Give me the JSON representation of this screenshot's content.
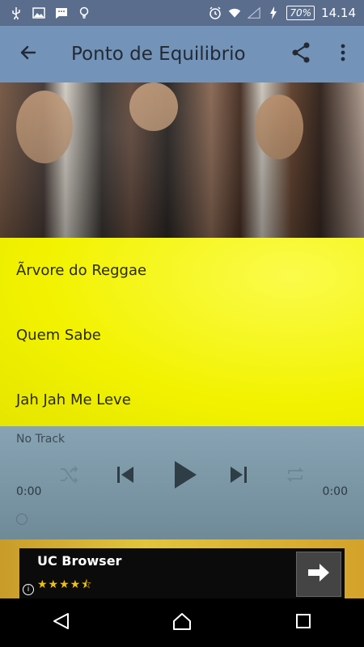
{
  "status_bar": {
    "battery": "70%",
    "time": "14.14",
    "icons": [
      "usb-icon",
      "image-icon",
      "bbm-icon",
      "bulb-icon",
      "alarm-icon",
      "wifi-icon",
      "signal-icon",
      "charging-icon"
    ]
  },
  "app_bar": {
    "title": "Ponto de Equilibrio",
    "icons": [
      "back-arrow-icon",
      "share-icon",
      "overflow-menu-icon"
    ]
  },
  "tracks": [
    "Ãrvore do Reggae",
    "Quem Sabe",
    "Jah Jah Me Leve"
  ],
  "player": {
    "now_playing": "No Track",
    "elapsed": "0:00",
    "duration": "0:00",
    "controls": [
      "shuffle-icon",
      "previous-icon",
      "play-icon",
      "next-icon",
      "repeat-icon"
    ]
  },
  "ad": {
    "app_name": "UC Browser",
    "rating": 4.5,
    "stars_text": "★★★★⯪",
    "info": "i"
  },
  "nav": [
    "back-nav-icon",
    "home-nav-icon",
    "recents-nav-icon"
  ],
  "colors": {
    "status_bar": "#5a6d8c",
    "app_bar": "#7493b8",
    "list_bg": "#f2f200",
    "player_bg": "#7f99a8",
    "ad_bg": "#0b0b0b",
    "star": "#f2c200"
  }
}
